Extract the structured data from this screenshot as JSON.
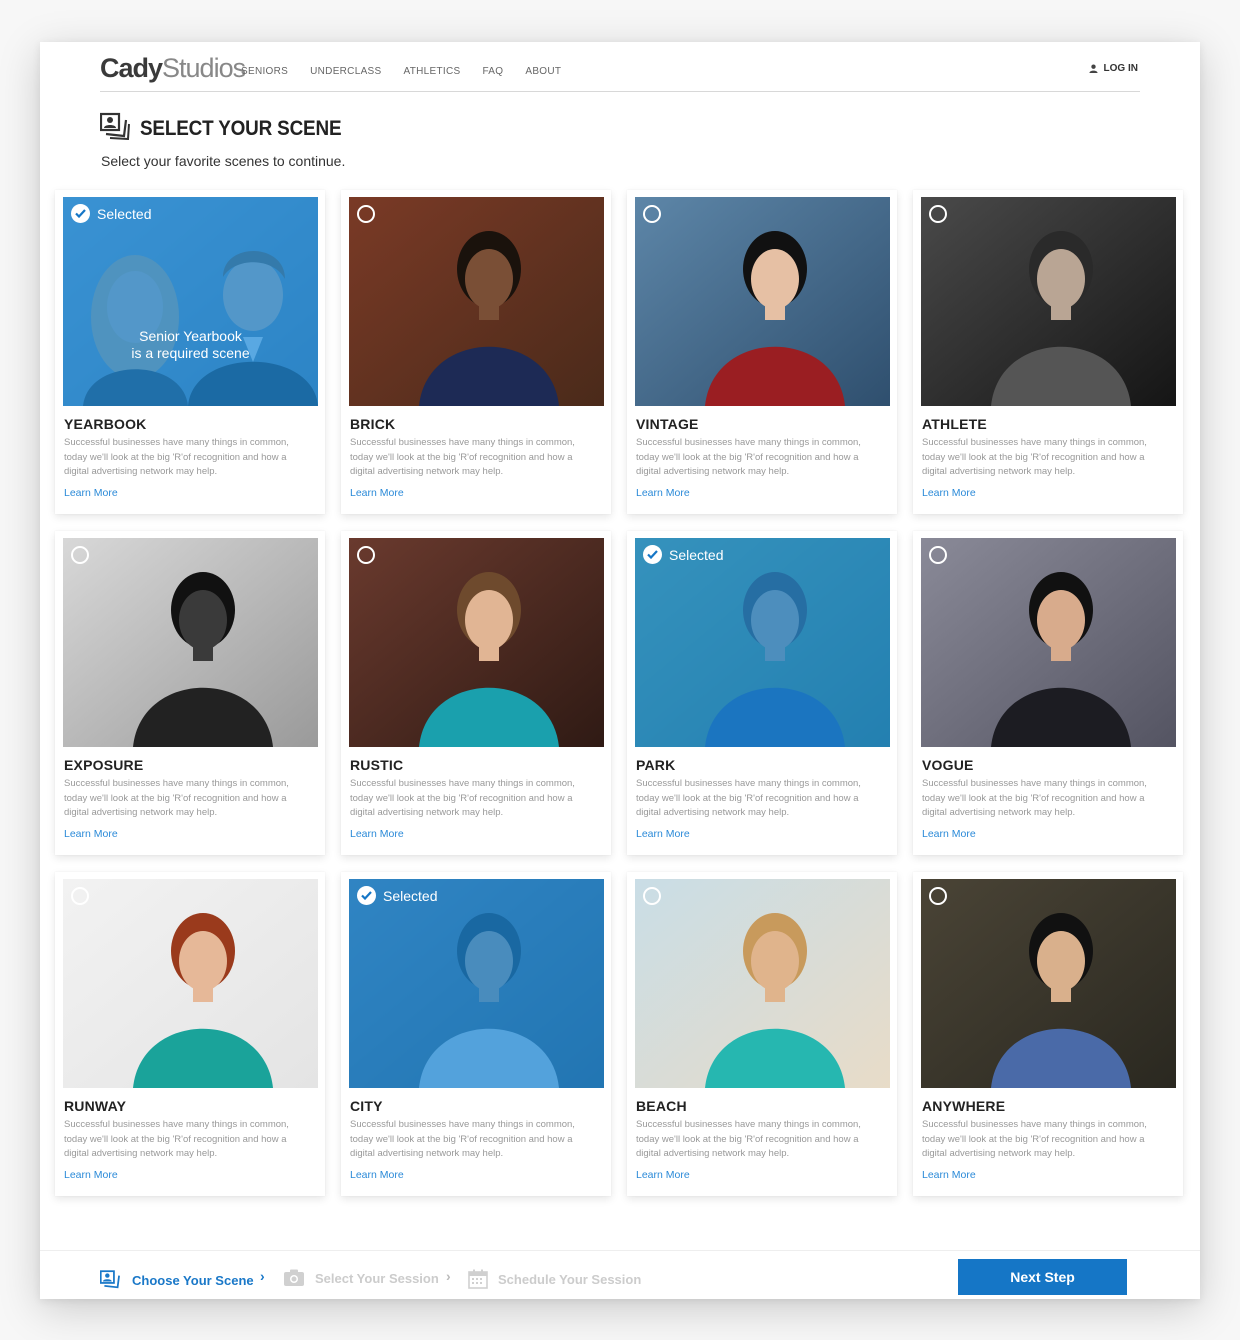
{
  "brand": {
    "bold": "Cady",
    "light": "Studios"
  },
  "nav": [
    "SENIORS",
    "UNDERCLASS",
    "ATHLETICS",
    "FAQ",
    "ABOUT"
  ],
  "login_label": "LOG IN",
  "page_title": "SELECT YOUR SCENE",
  "subtitle": "Select your favorite scenes to continue.",
  "selected_label": "Selected",
  "required_note": [
    "Senior Yearbook",
    "is a required scene"
  ],
  "learn_more": "Learn More",
  "description": "Successful businesses have many things in common, today we'll look at the big 'R'of recognition and how a digital advertising network may help.",
  "scenes": [
    {
      "name": "YEARBOOK",
      "selected": true,
      "required": true
    },
    {
      "name": "BRICK",
      "selected": false
    },
    {
      "name": "VINTAGE",
      "selected": false
    },
    {
      "name": "ATHLETE",
      "selected": false
    },
    {
      "name": "EXPOSURE",
      "selected": false
    },
    {
      "name": "RUSTIC",
      "selected": false
    },
    {
      "name": "PARK",
      "selected": true
    },
    {
      "name": "VOGUE",
      "selected": false
    },
    {
      "name": "RUNWAY",
      "selected": false
    },
    {
      "name": "CITY",
      "selected": true
    },
    {
      "name": "BEACH",
      "selected": false
    },
    {
      "name": "ANYWHERE",
      "selected": false
    }
  ],
  "footer": {
    "steps": [
      "Choose Your Scene",
      "Select Your Session",
      "Schedule Your Session"
    ],
    "active_step": 0,
    "next_label": "Next Step"
  },
  "colors": {
    "accent": "#1576c6",
    "selected_overlay": "#1987d7",
    "link": "#2b8ad8"
  }
}
